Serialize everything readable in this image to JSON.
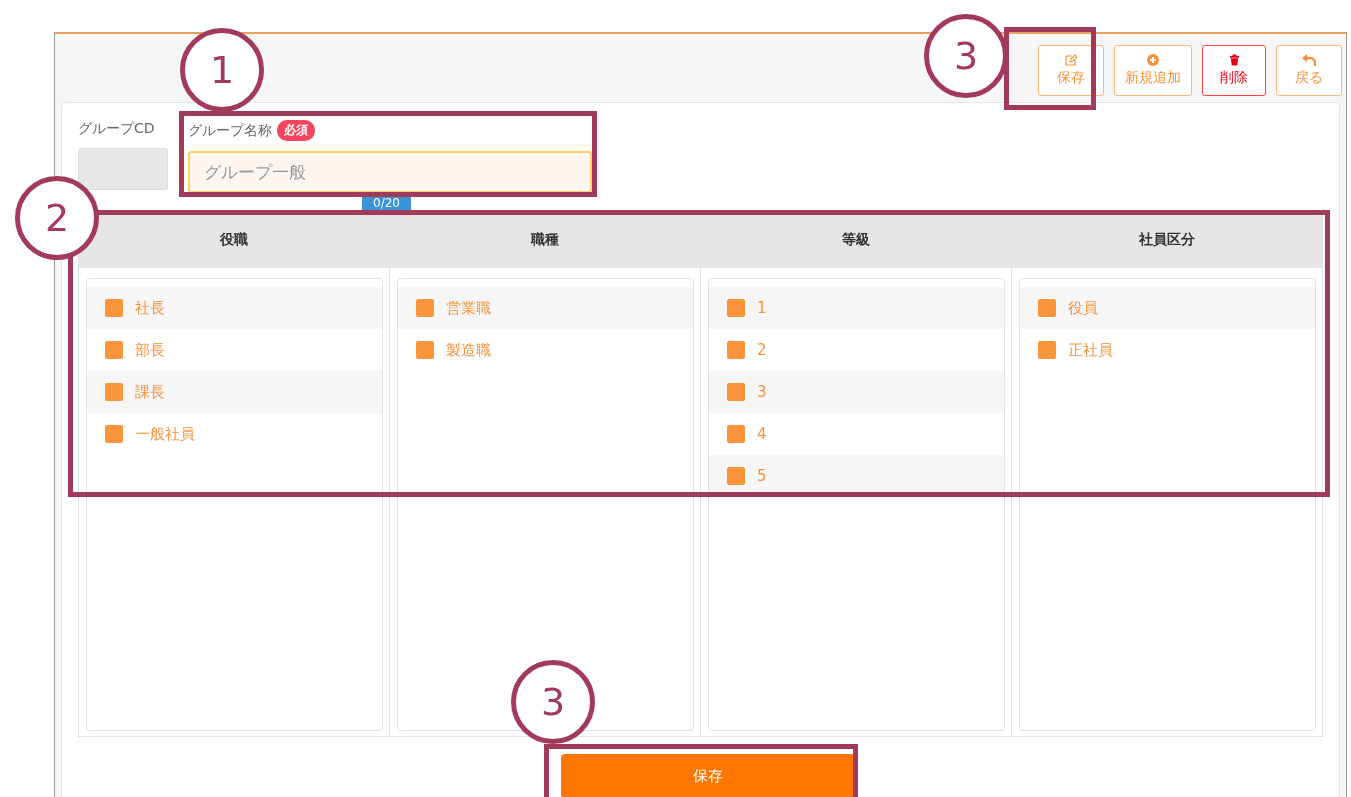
{
  "toolbar": [
    {
      "kind": "edit",
      "label": "保存"
    },
    {
      "kind": "add",
      "label": "新規追加"
    },
    {
      "kind": "delete",
      "label": "削除"
    },
    {
      "kind": "back",
      "label": "戻る"
    }
  ],
  "form": {
    "code": {
      "label": "グループCD"
    },
    "name": {
      "label": "グループ名称",
      "required_badge": "必須",
      "placeholder": "グループ一般",
      "counter": "0/20"
    }
  },
  "table": {
    "columns": [
      {
        "title": "役職",
        "items": [
          {
            "label": "社長",
            "checked": true
          },
          {
            "label": "部長",
            "checked": true
          },
          {
            "label": "課長",
            "checked": true
          },
          {
            "label": "一般社員",
            "checked": true
          }
        ]
      },
      {
        "title": "職種",
        "items": [
          {
            "label": "営業職",
            "checked": true
          },
          {
            "label": "製造職",
            "checked": true
          }
        ]
      },
      {
        "title": "等級",
        "items": [
          {
            "label": "1",
            "checked": true
          },
          {
            "label": "2",
            "checked": true
          },
          {
            "label": "3",
            "checked": true
          },
          {
            "label": "4",
            "checked": true
          },
          {
            "label": "5",
            "checked": true
          }
        ]
      },
      {
        "title": "社員区分",
        "items": [
          {
            "label": "役員",
            "checked": true
          },
          {
            "label": "正社員",
            "checked": true
          }
        ]
      }
    ]
  },
  "save_button": "保存",
  "callouts": [
    {
      "number": "1"
    },
    {
      "number": "2"
    },
    {
      "number": "3"
    },
    {
      "number": "3"
    }
  ]
}
